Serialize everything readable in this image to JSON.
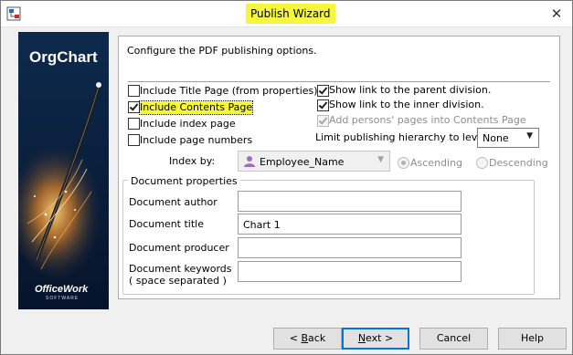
{
  "window": {
    "title": "Publish Wizard"
  },
  "side_logo": {
    "brand": "OrgChart",
    "maker": "OfficeWork",
    "maker_sub": "SOFTWARE"
  },
  "panel": {
    "instruction": "Configure the PDF publishing options.",
    "left_options": [
      {
        "label": "Include Title Page (from properties)",
        "checked": false
      },
      {
        "label": "Include Contents Page",
        "checked": true
      },
      {
        "label": "Include index page",
        "checked": false
      },
      {
        "label": "Include page numbers",
        "checked": false
      }
    ],
    "right_options": [
      {
        "label": "Show link to the parent division.",
        "checked": true,
        "disabled": false
      },
      {
        "label": "Show link to the inner division.",
        "checked": true,
        "disabled": false
      },
      {
        "label": "Add persons' pages into Contents Page",
        "checked": true,
        "disabled": true
      }
    ],
    "hierarchy": {
      "label": "Limit publishing hierarchy to level:",
      "value": "None"
    },
    "index_by": {
      "label": "Index by:",
      "value": "Employee_Name",
      "ascending_label": "Ascending",
      "descending_label": "Descending",
      "selected": "Ascending"
    },
    "document_properties": {
      "title": "Document properties",
      "author_label": "Document author",
      "author_value": "",
      "title_label": "Document title",
      "title_value": "Chart 1",
      "producer_label": "Document producer",
      "producer_value": "",
      "keywords_label_1": "Document keywords",
      "keywords_label_2": "( space separated )",
      "keywords_value": ""
    }
  },
  "buttons": {
    "back": {
      "prefix": "< ",
      "mnemonic": "B",
      "rest": "ack"
    },
    "next": {
      "mnemonic": "N",
      "rest": "ext >"
    },
    "cancel": "Cancel",
    "help": "Help"
  },
  "colors": {
    "highlight": "#f6f63a",
    "accent": "#0078d7",
    "side_bg": "#0a1c36"
  }
}
